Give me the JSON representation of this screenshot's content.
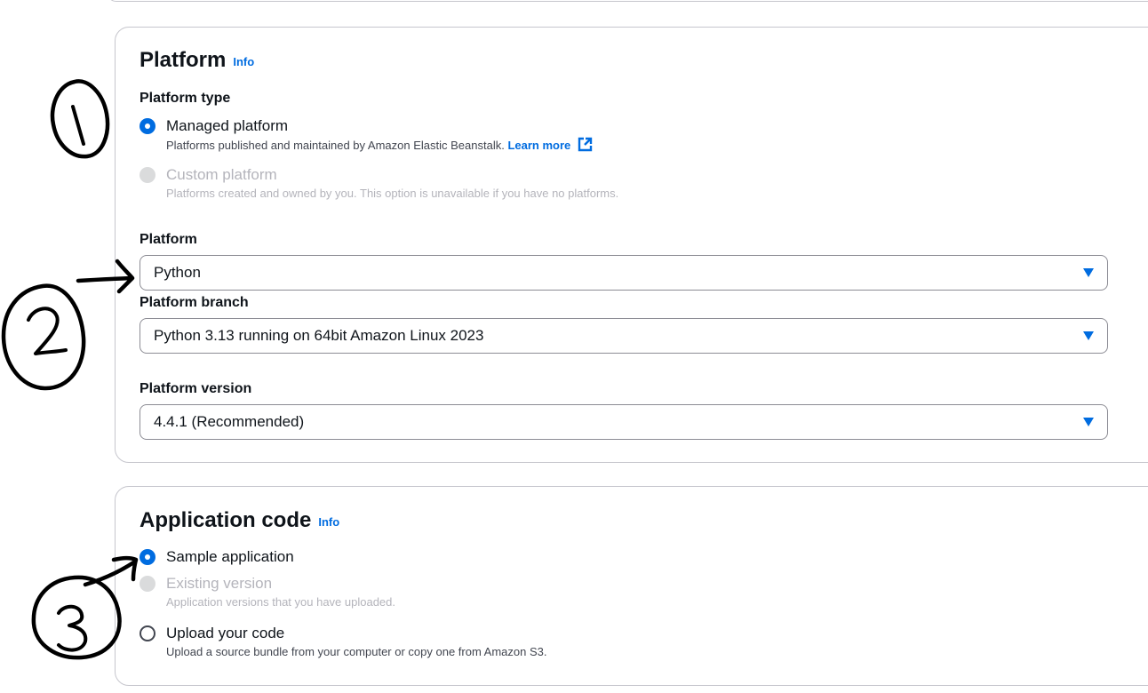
{
  "platform_section": {
    "title": "Platform",
    "info": "Info",
    "platform_type_label": "Platform type",
    "options": [
      {
        "label": "Managed platform",
        "description": "Platforms published and maintained by Amazon Elastic Beanstalk.",
        "link": "Learn more",
        "state": "selected"
      },
      {
        "label": "Custom platform",
        "description": "Platforms created and owned by you. This option is unavailable if you have no platforms.",
        "state": "disabled"
      }
    ],
    "platform_label": "Platform",
    "platform_value": "Python",
    "branch_label": "Platform branch",
    "branch_value": "Python 3.13 running on 64bit Amazon Linux 2023",
    "version_label": "Platform version",
    "version_value": "4.4.1 (Recommended)"
  },
  "application_code_section": {
    "title": "Application code",
    "info": "Info",
    "options": [
      {
        "label": "Sample application",
        "state": "selected"
      },
      {
        "label": "Existing version",
        "description": "Application versions that you have uploaded.",
        "state": "disabled"
      },
      {
        "label": "Upload your code",
        "description": "Upload a source bundle from your computer or copy one from Amazon S3.",
        "state": "unselected"
      }
    ]
  },
  "annotations": [
    "1",
    "2",
    "3"
  ],
  "colors": {
    "accent": "#006ce0",
    "text": "#0f141a",
    "muted": "#424650",
    "disabled": "#b4b4bb",
    "border": "#8c8c94"
  }
}
